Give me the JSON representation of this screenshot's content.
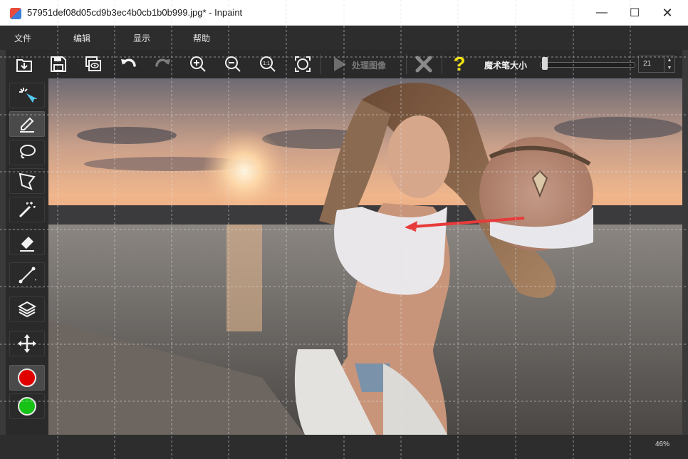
{
  "window": {
    "title": "57951def08d05cd9b3ec4b0cb1b0b999.jpg* - Inpaint",
    "minimize_glyph": "—",
    "maximize_glyph": "☐",
    "close_glyph": "✕"
  },
  "menu": {
    "items": [
      {
        "label": "文件"
      },
      {
        "label": "编辑"
      },
      {
        "label": "显示"
      },
      {
        "label": "帮助"
      }
    ]
  },
  "toolbar": {
    "buttons": [
      {
        "icon": "open-file-icon"
      },
      {
        "icon": "save-icon"
      },
      {
        "icon": "preview-icon"
      },
      {
        "icon": "undo-icon"
      },
      {
        "icon": "redo-icon"
      },
      {
        "icon": "zoom-in-icon"
      },
      {
        "icon": "zoom-out-icon"
      },
      {
        "icon": "actual-size-icon"
      },
      {
        "icon": "fit-window-icon"
      },
      {
        "icon": "play-icon"
      },
      {
        "icon": "cancel-icon"
      },
      {
        "icon": "help-icon"
      }
    ],
    "actual_size_text": "1:1",
    "process_label": "处理图像",
    "help_glyph": "?",
    "brush_size_label": "魔术笔大小",
    "brush_size_value": "21",
    "brush_slider_level": 0.05
  },
  "tools": [
    {
      "icon": "magic-selection-icon"
    },
    {
      "icon": "marker-icon",
      "active": true
    },
    {
      "icon": "lasso-icon"
    },
    {
      "icon": "polygon-lasso-icon"
    },
    {
      "icon": "magic-wand-icon"
    },
    {
      "icon": "eraser-icon"
    },
    {
      "icon": "line-icon"
    },
    {
      "icon": "layers-icon"
    },
    {
      "icon": "move-icon"
    }
  ],
  "colors": {
    "red_marker": "#e00000",
    "green_marker": "#16c216",
    "accent_arrow": "#e83a3a",
    "help_yellow": "#f2e20a",
    "background_dark": "#2d2d2d"
  },
  "status": {
    "zoom": "46%"
  }
}
